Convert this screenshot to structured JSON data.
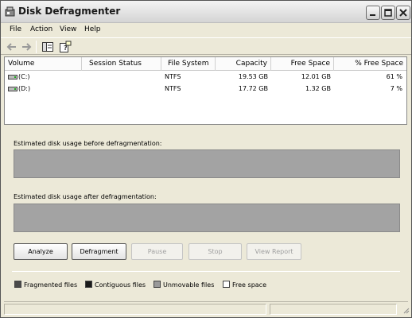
{
  "window": {
    "title": "Disk Defragmenter"
  },
  "menu": {
    "file": "File",
    "action": "Action",
    "view": "View",
    "help": "Help"
  },
  "toolbar": {
    "back_icon": "back-arrow-icon",
    "forward_icon": "forward-arrow-icon",
    "console_icon": "console-tree-icon",
    "help_icon": "help-icon"
  },
  "list": {
    "columns": [
      "Volume",
      "Session Status",
      "File System",
      "Capacity",
      "Free Space",
      "% Free Space"
    ],
    "rows": [
      {
        "volume": "(C:)",
        "session_status": "",
        "file_system": "NTFS",
        "capacity": "19.53 GB",
        "free_space": "12.01 GB",
        "pct_free": "61 %"
      },
      {
        "volume": "(D:)",
        "session_status": "",
        "file_system": "NTFS",
        "capacity": "17.72 GB",
        "free_space": "1.32 GB",
        "pct_free": "7 %"
      }
    ]
  },
  "usage": {
    "before_label": "Estimated disk usage before defragmentation:",
    "after_label": "Estimated disk usage after defragmentation:"
  },
  "buttons": {
    "analyze": "Analyze",
    "defragment": "Defragment",
    "pause": "Pause",
    "stop": "Stop",
    "view_report": "View Report"
  },
  "legend": {
    "fragmented": "Fragmented files",
    "contiguous": "Contiguous files",
    "unmovable": "Unmovable files",
    "free": "Free space"
  },
  "colors": {
    "window_bg": "#ece9d8",
    "usage_bar": "#a3a3a3",
    "fragmented": "#4a4a4a",
    "contiguous": "#1a1a1a",
    "unmovable": "#9a9a9a",
    "free": "#ffffff"
  }
}
